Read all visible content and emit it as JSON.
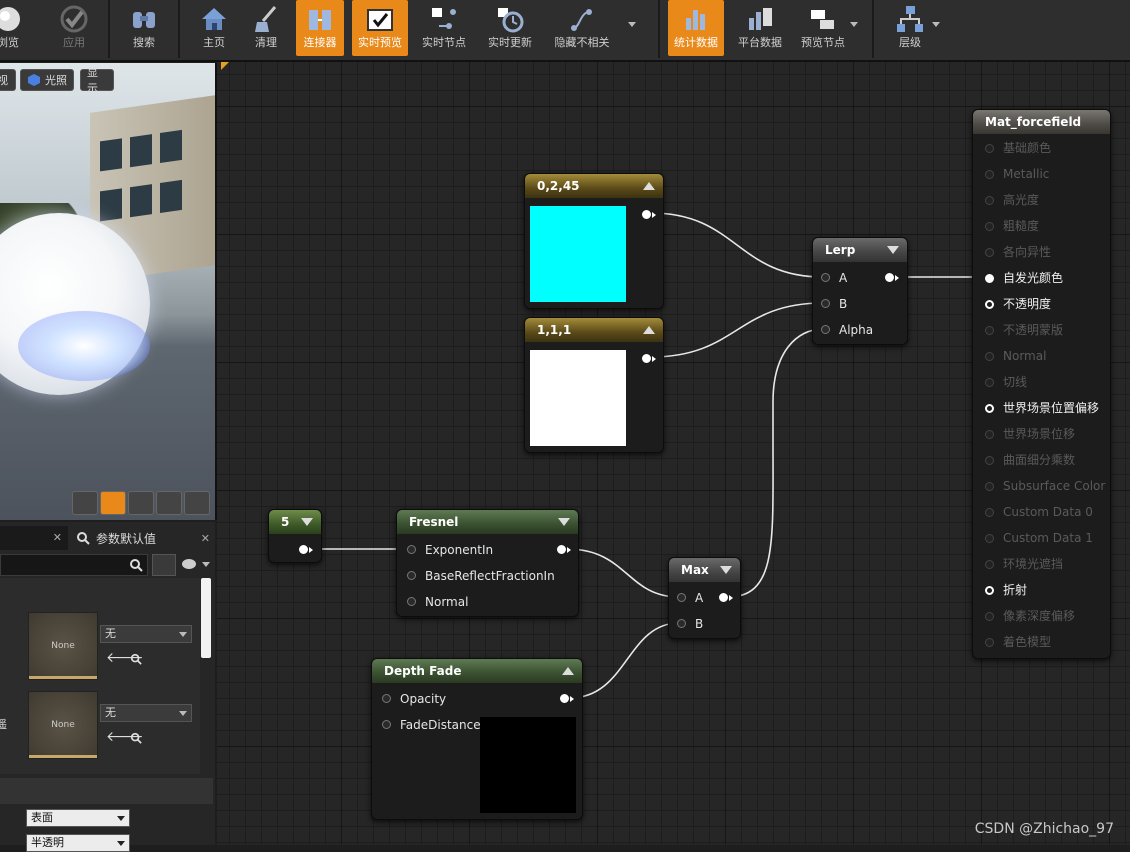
{
  "toolbar": {
    "buttons": [
      {
        "label": "浏览",
        "icon": "sphere-icon",
        "state": "normal"
      },
      {
        "label": "应用",
        "icon": "checkmark-icon",
        "state": "disabled"
      },
      {
        "label": "搜索",
        "icon": "binoculars-icon",
        "state": "normal"
      },
      {
        "label": "主页",
        "icon": "home-icon",
        "state": "normal"
      },
      {
        "label": "清理",
        "icon": "broom-icon",
        "state": "normal"
      },
      {
        "label": "连接器",
        "icon": "connector-icon",
        "state": "active"
      },
      {
        "label": "实时预览",
        "icon": "tv-check-icon",
        "state": "active"
      },
      {
        "label": "实时节点",
        "icon": "live-nodes-icon",
        "state": "normal"
      },
      {
        "label": "实时更新",
        "icon": "live-update-icon",
        "state": "normal"
      },
      {
        "label": "隐藏不相关",
        "icon": "hide-unrelated-icon",
        "state": "normal"
      },
      {
        "label": "统计数据",
        "icon": "stats-icon",
        "state": "active"
      },
      {
        "label": "平台数据",
        "icon": "platform-stats-icon",
        "state": "normal"
      },
      {
        "label": "预览节点",
        "icon": "preview-node-icon",
        "state": "normal"
      },
      {
        "label": "层级",
        "icon": "hierarchy-icon",
        "state": "normal"
      }
    ]
  },
  "viewport": {
    "buttons": [
      "视",
      "光照",
      "显示"
    ]
  },
  "details_panel": {
    "tab_label": "参数默认值",
    "textures": [
      {
        "thumb_label": "None",
        "combo_value": "无"
      },
      {
        "thumb_label": "None",
        "combo_value": "无"
      }
    ],
    "side_label": "遥",
    "blend_combo": "表面",
    "shading_combo": "半透明"
  },
  "nodes": {
    "const_a": {
      "title": "0,2,45",
      "color": "#00ffff"
    },
    "const_b": {
      "title": "1,1,1",
      "color": "#ffffff"
    },
    "scalar": {
      "title": "5"
    },
    "fresnel": {
      "title": "Fresnel",
      "pins": [
        "ExponentIn",
        "BaseReflectFractionIn",
        "Normal"
      ]
    },
    "depth_fade": {
      "title": "Depth Fade",
      "pins": [
        "Opacity",
        "FadeDistance"
      ]
    },
    "max": {
      "title": "Max",
      "pins": [
        "A",
        "B"
      ]
    },
    "lerp": {
      "title": "Lerp",
      "pins": [
        "A",
        "B",
        "Alpha"
      ]
    }
  },
  "material": {
    "title": "Mat_forcefield",
    "inputs": [
      {
        "label": "基础颜色",
        "active": false
      },
      {
        "label": "Metallic",
        "active": false
      },
      {
        "label": "高光度",
        "active": false
      },
      {
        "label": "粗糙度",
        "active": false
      },
      {
        "label": "各向异性",
        "active": false
      },
      {
        "label": "自发光颜色",
        "active": true
      },
      {
        "label": "不透明度",
        "active": true
      },
      {
        "label": "不透明蒙版",
        "active": false
      },
      {
        "label": "Normal",
        "active": false
      },
      {
        "label": "切线",
        "active": false
      },
      {
        "label": "世界场景位置偏移",
        "active": true
      },
      {
        "label": "世界场景位移",
        "active": false
      },
      {
        "label": "曲面细分乘数",
        "active": false
      },
      {
        "label": "Subsurface Color",
        "active": false
      },
      {
        "label": "Custom Data 0",
        "active": false
      },
      {
        "label": "Custom Data 1",
        "active": false
      },
      {
        "label": "环境光遮挡",
        "active": false
      },
      {
        "label": "折射",
        "active": true
      },
      {
        "label": "像素深度偏移",
        "active": false
      },
      {
        "label": "着色模型",
        "active": false
      }
    ]
  },
  "watermark": "CSDN @Zhichao_97"
}
